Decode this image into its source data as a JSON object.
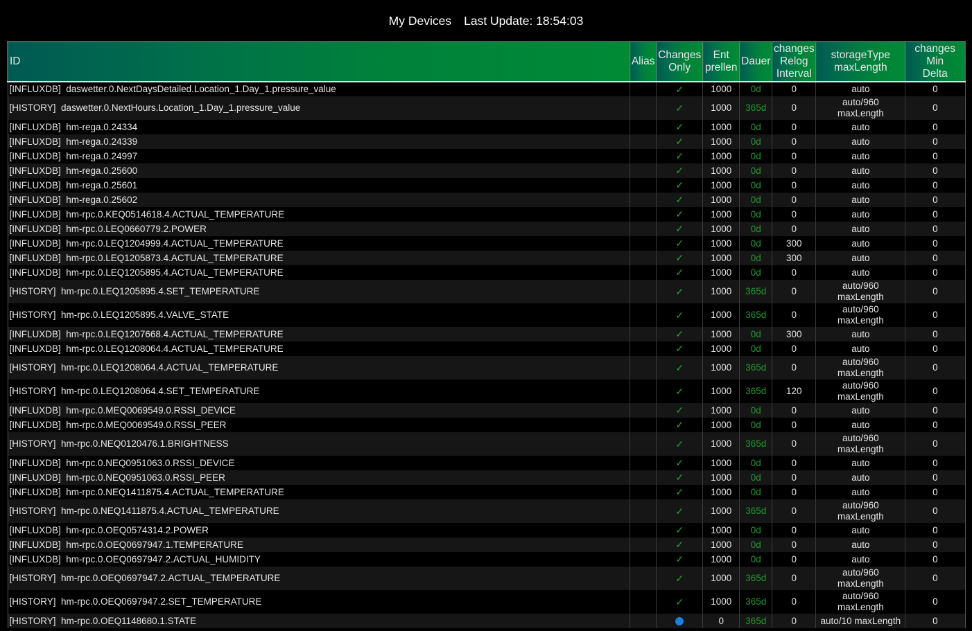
{
  "header": {
    "title": "My Devices",
    "last_update_label": "Last Update: 18:54:03"
  },
  "colors": {
    "background": "#000000",
    "header_gradient_start": "#005a52",
    "header_gradient_end": "#008a36",
    "check_color": "#1faa2a",
    "dauer_color": "#1f9a2a",
    "status_dot_color": "#1d7fe0"
  },
  "table": {
    "columns": {
      "id": "ID",
      "alias": "Alias",
      "changes_only": [
        "Changes",
        "Only"
      ],
      "entprellen": [
        "Ent",
        "prellen"
      ],
      "dauer": "Dauer",
      "relog": [
        "changes",
        "Relog",
        "Interval"
      ],
      "storage": [
        "storageType",
        "maxLength"
      ],
      "min_delta": [
        "changes",
        "Min",
        "Delta"
      ]
    },
    "rows": [
      {
        "adapter": "[INFLUXDB]",
        "id": "daswetter.0.NextDaysDetailed.Location_1.Day_1.pressure_value",
        "alias": "",
        "changes_only": "check",
        "entprellen": "1000",
        "dauer": "0d",
        "relog": "0",
        "storage": [
          "auto"
        ],
        "min_delta": "0"
      },
      {
        "adapter": "[HISTORY]",
        "id": "daswetter.0.NextHours.Location_1.Day_1.pressure_value",
        "alias": "",
        "changes_only": "check",
        "entprellen": "1000",
        "dauer": "365d",
        "relog": "0",
        "storage": [
          "auto/960",
          "maxLength"
        ],
        "min_delta": "0"
      },
      {
        "adapter": "[INFLUXDB]",
        "id": "hm-rega.0.24334",
        "alias": "",
        "changes_only": "check",
        "entprellen": "1000",
        "dauer": "0d",
        "relog": "0",
        "storage": [
          "auto"
        ],
        "min_delta": "0"
      },
      {
        "adapter": "[INFLUXDB]",
        "id": "hm-rega.0.24339",
        "alias": "",
        "changes_only": "check",
        "entprellen": "1000",
        "dauer": "0d",
        "relog": "0",
        "storage": [
          "auto"
        ],
        "min_delta": "0"
      },
      {
        "adapter": "[INFLUXDB]",
        "id": "hm-rega.0.24997",
        "alias": "",
        "changes_only": "check",
        "entprellen": "1000",
        "dauer": "0d",
        "relog": "0",
        "storage": [
          "auto"
        ],
        "min_delta": "0"
      },
      {
        "adapter": "[INFLUXDB]",
        "id": "hm-rega.0.25600",
        "alias": "",
        "changes_only": "check",
        "entprellen": "1000",
        "dauer": "0d",
        "relog": "0",
        "storage": [
          "auto"
        ],
        "min_delta": "0"
      },
      {
        "adapter": "[INFLUXDB]",
        "id": "hm-rega.0.25601",
        "alias": "",
        "changes_only": "check",
        "entprellen": "1000",
        "dauer": "0d",
        "relog": "0",
        "storage": [
          "auto"
        ],
        "min_delta": "0"
      },
      {
        "adapter": "[INFLUXDB]",
        "id": "hm-rega.0.25602",
        "alias": "",
        "changes_only": "check",
        "entprellen": "1000",
        "dauer": "0d",
        "relog": "0",
        "storage": [
          "auto"
        ],
        "min_delta": "0"
      },
      {
        "adapter": "[INFLUXDB]",
        "id": "hm-rpc.0.KEQ0514618.4.ACTUAL_TEMPERATURE",
        "alias": "",
        "changes_only": "check",
        "entprellen": "1000",
        "dauer": "0d",
        "relog": "0",
        "storage": [
          "auto"
        ],
        "min_delta": "0"
      },
      {
        "adapter": "[INFLUXDB]",
        "id": "hm-rpc.0.LEQ0660779.2.POWER",
        "alias": "",
        "changes_only": "check",
        "entprellen": "1000",
        "dauer": "0d",
        "relog": "0",
        "storage": [
          "auto"
        ],
        "min_delta": "0"
      },
      {
        "adapter": "[INFLUXDB]",
        "id": "hm-rpc.0.LEQ1204999.4.ACTUAL_TEMPERATURE",
        "alias": "",
        "changes_only": "check",
        "entprellen": "1000",
        "dauer": "0d",
        "relog": "300",
        "storage": [
          "auto"
        ],
        "min_delta": "0"
      },
      {
        "adapter": "[INFLUXDB]",
        "id": "hm-rpc.0.LEQ1205873.4.ACTUAL_TEMPERATURE",
        "alias": "",
        "changes_only": "check",
        "entprellen": "1000",
        "dauer": "0d",
        "relog": "300",
        "storage": [
          "auto"
        ],
        "min_delta": "0"
      },
      {
        "adapter": "[INFLUXDB]",
        "id": "hm-rpc.0.LEQ1205895.4.ACTUAL_TEMPERATURE",
        "alias": "",
        "changes_only": "check",
        "entprellen": "1000",
        "dauer": "0d",
        "relog": "0",
        "storage": [
          "auto"
        ],
        "min_delta": "0"
      },
      {
        "adapter": "[HISTORY]",
        "id": "hm-rpc.0.LEQ1205895.4.SET_TEMPERATURE",
        "alias": "",
        "changes_only": "check",
        "entprellen": "1000",
        "dauer": "365d",
        "relog": "0",
        "storage": [
          "auto/960",
          "maxLength"
        ],
        "min_delta": "0"
      },
      {
        "adapter": "[HISTORY]",
        "id": "hm-rpc.0.LEQ1205895.4.VALVE_STATE",
        "alias": "",
        "changes_only": "check",
        "entprellen": "1000",
        "dauer": "365d",
        "relog": "0",
        "storage": [
          "auto/960",
          "maxLength"
        ],
        "min_delta": "0"
      },
      {
        "adapter": "[INFLUXDB]",
        "id": "hm-rpc.0.LEQ1207668.4.ACTUAL_TEMPERATURE",
        "alias": "",
        "changes_only": "check",
        "entprellen": "1000",
        "dauer": "0d",
        "relog": "300",
        "storage": [
          "auto"
        ],
        "min_delta": "0"
      },
      {
        "adapter": "[INFLUXDB]",
        "id": "hm-rpc.0.LEQ1208064.4.ACTUAL_TEMPERATURE",
        "alias": "",
        "changes_only": "check",
        "entprellen": "1000",
        "dauer": "0d",
        "relog": "0",
        "storage": [
          "auto"
        ],
        "min_delta": "0"
      },
      {
        "adapter": "[HISTORY]",
        "id": "hm-rpc.0.LEQ1208064.4.ACTUAL_TEMPERATURE",
        "alias": "",
        "changes_only": "check",
        "entprellen": "1000",
        "dauer": "365d",
        "relog": "0",
        "storage": [
          "auto/960",
          "maxLength"
        ],
        "min_delta": "0"
      },
      {
        "adapter": "[HISTORY]",
        "id": "hm-rpc.0.LEQ1208064.4.SET_TEMPERATURE",
        "alias": "",
        "changes_only": "check",
        "entprellen": "1000",
        "dauer": "365d",
        "relog": "120",
        "storage": [
          "auto/960",
          "maxLength"
        ],
        "min_delta": "0"
      },
      {
        "adapter": "[INFLUXDB]",
        "id": "hm-rpc.0.MEQ0069549.0.RSSI_DEVICE",
        "alias": "",
        "changes_only": "check",
        "entprellen": "1000",
        "dauer": "0d",
        "relog": "0",
        "storage": [
          "auto"
        ],
        "min_delta": "0"
      },
      {
        "adapter": "[INFLUXDB]",
        "id": "hm-rpc.0.MEQ0069549.0.RSSI_PEER",
        "alias": "",
        "changes_only": "check",
        "entprellen": "1000",
        "dauer": "0d",
        "relog": "0",
        "storage": [
          "auto"
        ],
        "min_delta": "0"
      },
      {
        "adapter": "[HISTORY]",
        "id": "hm-rpc.0.NEQ0120476.1.BRIGHTNESS",
        "alias": "",
        "changes_only": "check",
        "entprellen": "1000",
        "dauer": "365d",
        "relog": "0",
        "storage": [
          "auto/960",
          "maxLength"
        ],
        "min_delta": "0"
      },
      {
        "adapter": "[INFLUXDB]",
        "id": "hm-rpc.0.NEQ0951063.0.RSSI_DEVICE",
        "alias": "",
        "changes_only": "check",
        "entprellen": "1000",
        "dauer": "0d",
        "relog": "0",
        "storage": [
          "auto"
        ],
        "min_delta": "0"
      },
      {
        "adapter": "[INFLUXDB]",
        "id": "hm-rpc.0.NEQ0951063.0.RSSI_PEER",
        "alias": "",
        "changes_only": "check",
        "entprellen": "1000",
        "dauer": "0d",
        "relog": "0",
        "storage": [
          "auto"
        ],
        "min_delta": "0"
      },
      {
        "adapter": "[INFLUXDB]",
        "id": "hm-rpc.0.NEQ1411875.4.ACTUAL_TEMPERATURE",
        "alias": "",
        "changes_only": "check",
        "entprellen": "1000",
        "dauer": "0d",
        "relog": "0",
        "storage": [
          "auto"
        ],
        "min_delta": "0"
      },
      {
        "adapter": "[HISTORY]",
        "id": "hm-rpc.0.NEQ1411875.4.ACTUAL_TEMPERATURE",
        "alias": "",
        "changes_only": "check",
        "entprellen": "1000",
        "dauer": "365d",
        "relog": "0",
        "storage": [
          "auto/960",
          "maxLength"
        ],
        "min_delta": "0"
      },
      {
        "adapter": "[INFLUXDB]",
        "id": "hm-rpc.0.OEQ0574314.2.POWER",
        "alias": "",
        "changes_only": "check",
        "entprellen": "1000",
        "dauer": "0d",
        "relog": "0",
        "storage": [
          "auto"
        ],
        "min_delta": "0"
      },
      {
        "adapter": "[INFLUXDB]",
        "id": "hm-rpc.0.OEQ0697947.1.TEMPERATURE",
        "alias": "",
        "changes_only": "check",
        "entprellen": "1000",
        "dauer": "0d",
        "relog": "0",
        "storage": [
          "auto"
        ],
        "min_delta": "0"
      },
      {
        "adapter": "[INFLUXDB]",
        "id": "hm-rpc.0.OEQ0697947.2.ACTUAL_HUMIDITY",
        "alias": "",
        "changes_only": "check",
        "entprellen": "1000",
        "dauer": "0d",
        "relog": "0",
        "storage": [
          "auto"
        ],
        "min_delta": "0"
      },
      {
        "adapter": "[HISTORY]",
        "id": "hm-rpc.0.OEQ0697947.2.ACTUAL_TEMPERATURE",
        "alias": "",
        "changes_only": "check",
        "entprellen": "1000",
        "dauer": "365d",
        "relog": "0",
        "storage": [
          "auto/960",
          "maxLength"
        ],
        "min_delta": "0"
      },
      {
        "adapter": "[HISTORY]",
        "id": "hm-rpc.0.OEQ0697947.2.SET_TEMPERATURE",
        "alias": "",
        "changes_only": "check",
        "entprellen": "1000",
        "dauer": "365d",
        "relog": "0",
        "storage": [
          "auto/960",
          "maxLength"
        ],
        "min_delta": "0"
      },
      {
        "adapter": "[HISTORY]",
        "id": "hm-rpc.0.OEQ1148680.1.STATE",
        "alias": "",
        "changes_only": "dot",
        "entprellen": "0",
        "dauer": "365d",
        "relog": "0",
        "storage": [
          "auto/10 maxLength"
        ],
        "min_delta": "0"
      }
    ]
  }
}
